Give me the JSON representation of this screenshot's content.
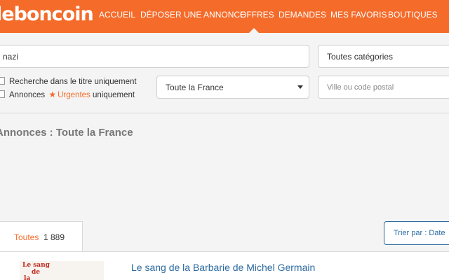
{
  "header": {
    "logo": "leboncoin",
    "accent_color": "#f56b2a",
    "nav": [
      {
        "label": "ACCUEIL",
        "active": false
      },
      {
        "label": "DÉPOSER UNE ANNONCE",
        "active": false
      },
      {
        "label": "OFFRES",
        "active": true
      },
      {
        "label": "DEMANDES",
        "active": false
      },
      {
        "label": "MES FAVORIS",
        "active": false
      },
      {
        "label": "BOUTIQUES",
        "active": false
      }
    ]
  },
  "search": {
    "keyword_value": "nazi",
    "category_value": "Toutes catégories",
    "title_only_label": "Recherche dans le titre uniquement",
    "urgent_prefix": "Annonces",
    "urgent_word": "Urgentes",
    "urgent_suffix": "uniquement",
    "location_value": "Toute la France",
    "city_placeholder": "Ville ou code postal"
  },
  "results": {
    "section_title": "Annonces : Toute la France",
    "tab_label": "Toutes",
    "tab_count": "1 889",
    "sort_label": "Trier par : Date",
    "items": [
      {
        "title": "Le sang de la Barbarie de Michel Germain",
        "thumb_lines": [
          "Le sang",
          "de",
          "la"
        ]
      }
    ]
  }
}
